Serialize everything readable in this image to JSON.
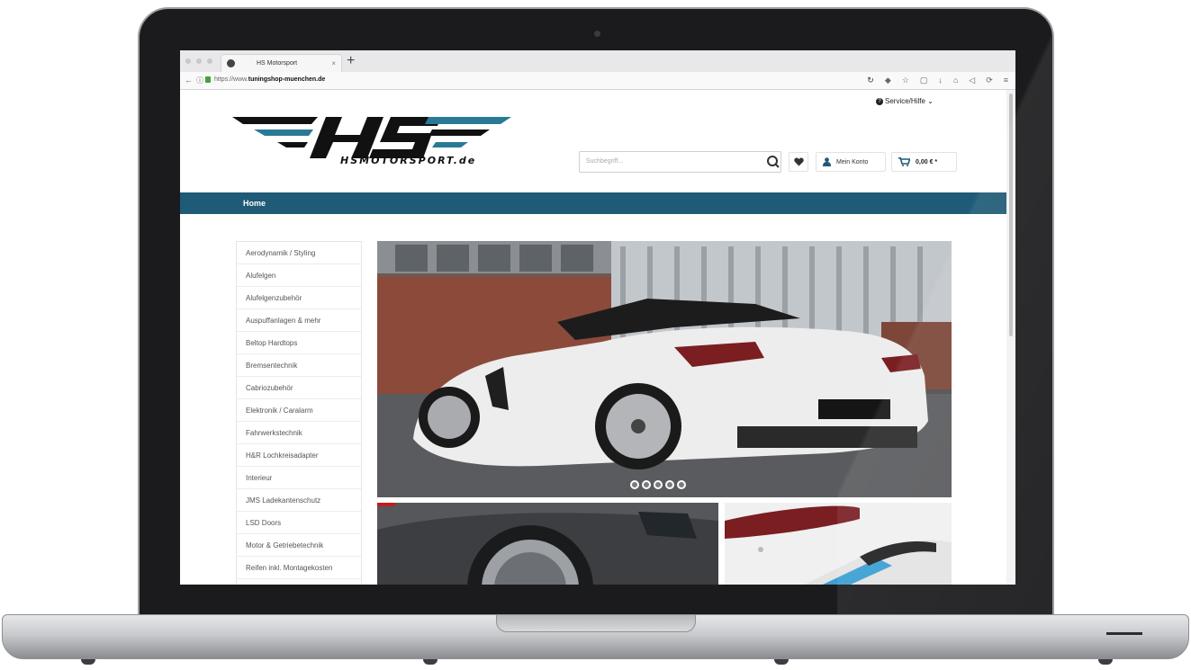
{
  "browser": {
    "tab_title": "HS Motorsport",
    "tab_close": "×",
    "new_tab": "+",
    "url_prefix": "https://www.",
    "url_host": "tuningshop-muenchen.de",
    "toolbar_icons": [
      "reload-icon",
      "extension-icon",
      "star-icon",
      "reader-icon",
      "download-icon",
      "home-icon",
      "sound-icon",
      "sync-icon",
      "menu-icon"
    ]
  },
  "header": {
    "service_label": "Service/Hilfe",
    "service_caret": "⌄",
    "logo_text": "HSMOTORSPORT.de",
    "search_placeholder": "Suchbegriff...",
    "account_label": "Mein Konto",
    "cart_total": "0,00 € *"
  },
  "nav": {
    "home": "Home"
  },
  "sidebar": {
    "categories": [
      "Aerodynamik / Styling",
      "Alufelgen",
      "Alufelgenzubehör",
      "Auspuffanlagen & mehr",
      "Beltop Hardtops",
      "Bremsentechnik",
      "Cabriozubehör",
      "Elektronik / Caralarm",
      "Fahrwerkstechnik",
      "H&R Lochkreisadapter",
      "Interieur",
      "JMS Ladekantenschutz",
      "LSD Doors",
      "Motor & Getriebetechnik",
      "Reifen inkl. Montagekosten"
    ]
  },
  "hero": {
    "slide_count": 5,
    "active_slide": 1
  },
  "colors": {
    "brand_blue": "#1f5a76",
    "logo_teal": "#2a7a96",
    "logo_dark": "#111111"
  }
}
